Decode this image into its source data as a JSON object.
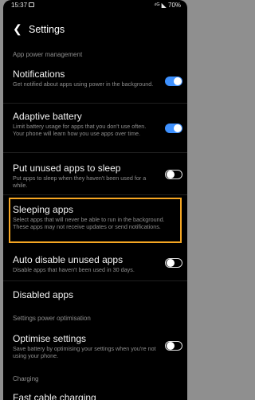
{
  "status_bar": {
    "time": "15:37",
    "right": "⁴ᴳ ◣ 70%"
  },
  "header": {
    "title": "Settings"
  },
  "sections": [
    {
      "title": "App power management"
    },
    {
      "title": "Settings power optimisation"
    },
    {
      "title": "Charging"
    }
  ],
  "items": [
    {
      "title": "Notifications",
      "desc": "Get notified about apps using power in the background.",
      "toggle": true
    },
    {
      "title": "Adaptive battery",
      "desc": "Limit battery usage for apps that you don't use often. Your phone will learn how you use apps over time.",
      "toggle": true
    },
    {
      "title": "Put unused apps to sleep",
      "desc": "Put apps to sleep when they haven't been used for a while.",
      "toggle": false
    },
    {
      "title": "Sleeping apps",
      "desc": "Select apps that will never be able to run in the background. These apps may not receive updates or send notifications."
    },
    {
      "title": "Auto disable unused apps",
      "desc": "Disable apps that haven't been used in 30 days.",
      "toggle": false
    },
    {
      "title": "Disabled apps"
    },
    {
      "title": "Optimise settings",
      "desc": "Save battery by optimising your settings when you're not using your phone.",
      "toggle": false
    },
    {
      "title": "Fast cable charging"
    }
  ],
  "colors": {
    "accent": "#3e91ff",
    "highlight": "#f5a623"
  }
}
